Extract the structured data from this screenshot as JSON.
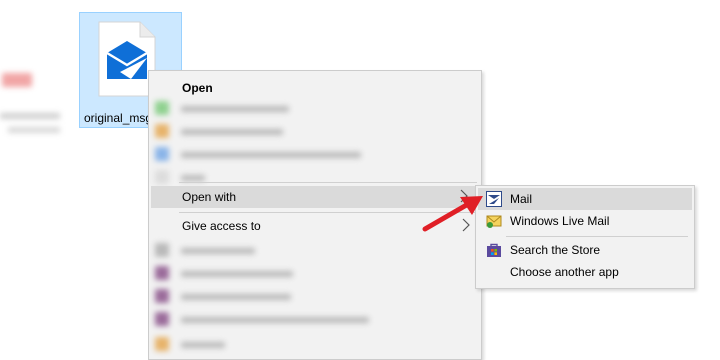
{
  "desktop": {
    "file_name": "original_msg"
  },
  "context_menu": {
    "open_label": "Open",
    "open_with_label": "Open with",
    "give_access_label": "Give access to"
  },
  "submenu": {
    "items": [
      {
        "label": "Mail",
        "icon": "mail-app-icon"
      },
      {
        "label": "Windows Live Mail",
        "icon": "windows-live-mail-icon"
      },
      {
        "label": "Search the Store",
        "icon": "store-icon"
      },
      {
        "label": "Choose another app",
        "icon": ""
      }
    ]
  },
  "colors": {
    "selection_fill": "#cce8ff",
    "selection_border": "#99d1ff",
    "menu_bg": "#f2f2f2",
    "menu_highlight": "#dadada",
    "mail_blue": "#0f6fd7",
    "arrow_red": "#e01f26"
  }
}
